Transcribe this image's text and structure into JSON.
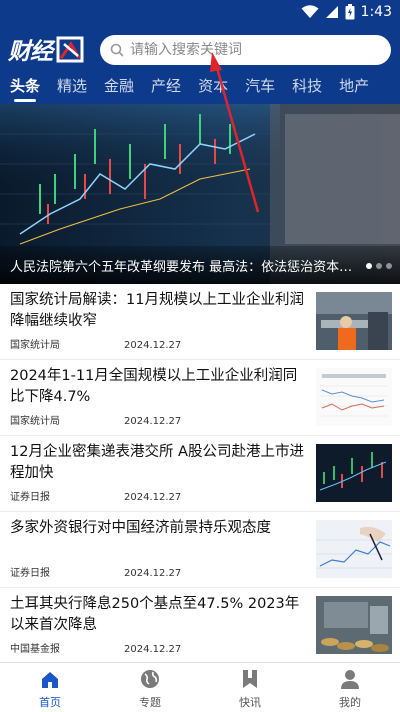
{
  "status_bar": {
    "time": "1:43"
  },
  "header": {
    "logo_text": "财经网",
    "search_placeholder": "请输入搜索关键词"
  },
  "tabs": [
    {
      "label": "头条"
    },
    {
      "label": "精选"
    },
    {
      "label": "金融"
    },
    {
      "label": "产经"
    },
    {
      "label": "资本"
    },
    {
      "label": "汽车"
    },
    {
      "label": "科技"
    },
    {
      "label": "地产"
    }
  ],
  "banner": {
    "caption": "人民法院第六个五年改革纲要发布 最高法：依法惩治资本市场违法犯罪"
  },
  "news": [
    {
      "title": "国家统计局解读：11月规模以上工业企业利润降幅继续收窄",
      "source": "国家统计局",
      "date": "2024.12.27"
    },
    {
      "title": "2024年1-11月全国规模以上工业企业利润同比下降4.7%",
      "source": "国家统计局",
      "date": "2024.12.27"
    },
    {
      "title": "12月企业密集递表港交所 A股公司赴港上市进程加快",
      "source": "证券日报",
      "date": "2024.12.27"
    },
    {
      "title": "多家外资银行对中国经济前景持乐观态度",
      "source": "证券日报",
      "date": "2024.12.27"
    },
    {
      "title": "土耳其央行降息250个基点至47.5% 2023年以来首次降息",
      "source": "中国基金报",
      "date": "2024.12.27"
    }
  ],
  "bottom_nav": [
    {
      "label": "首页",
      "icon": "home-icon"
    },
    {
      "label": "专题",
      "icon": "globe-icon"
    },
    {
      "label": "快讯",
      "icon": "bookmark-icon"
    },
    {
      "label": "我的",
      "icon": "person-icon"
    }
  ],
  "colors": {
    "header_bg": "#0e3a8c",
    "active_nav": "#1a56c8",
    "annotation": "#e0242b"
  }
}
